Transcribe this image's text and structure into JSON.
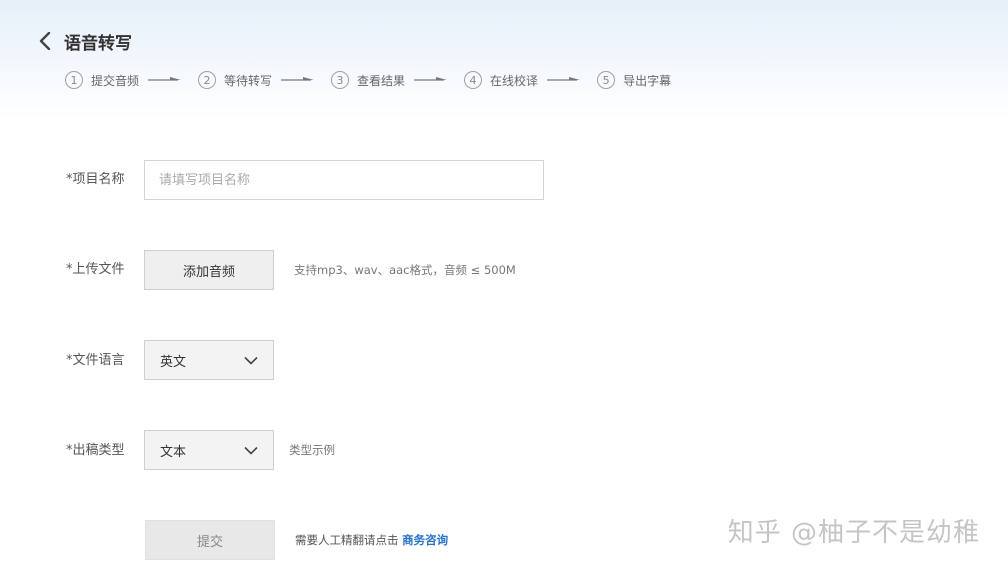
{
  "header": {
    "title": "语音转写",
    "back_icon": "chevron-left-icon"
  },
  "steps": [
    {
      "number": "1",
      "label": "提交音频"
    },
    {
      "number": "2",
      "label": "等待转写"
    },
    {
      "number": "3",
      "label": "查看结果"
    },
    {
      "number": "4",
      "label": "在线校译"
    },
    {
      "number": "5",
      "label": "导出字幕"
    }
  ],
  "form": {
    "project_name": {
      "label": "*项目名称",
      "placeholder": "请填写项目名称",
      "value": ""
    },
    "upload": {
      "label": "*上传文件",
      "button_label": "添加音频",
      "hint": "支持mp3、wav、aac格式，音频 ≤ 500M"
    },
    "language": {
      "label": "*文件语言",
      "selected": "英文"
    },
    "output_type": {
      "label": "*出稿类型",
      "selected": "文本",
      "example_label": "类型示例"
    },
    "submit_label": "提交",
    "consult_text": "需要人工精翻请点击",
    "consult_link": "商务咨询"
  },
  "watermark": "知乎 @柚子不是幼稚",
  "colors": {
    "link": "#2a72c8",
    "header_gradient": "#e6effa",
    "disabled_button": "#e8e8e8"
  }
}
